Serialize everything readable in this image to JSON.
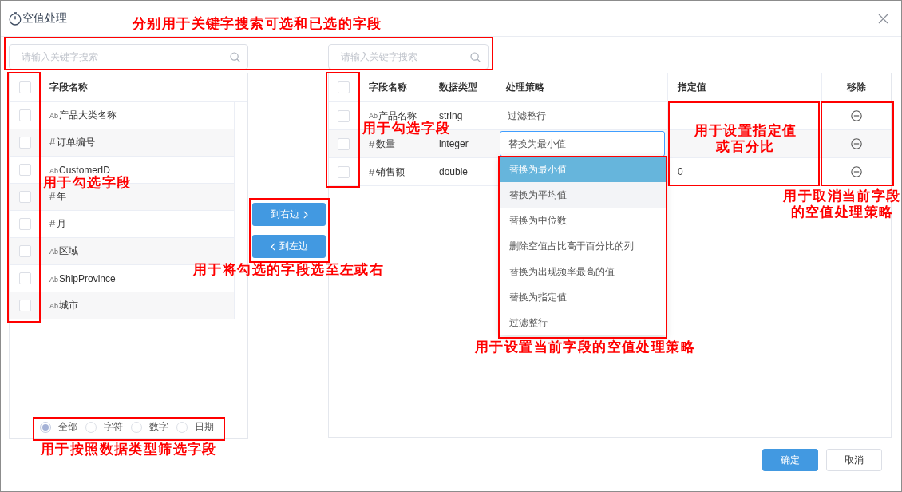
{
  "window": {
    "title": "空值处理"
  },
  "left_panel": {
    "search": {
      "placeholder": "请输入关键字搜索"
    },
    "select_all": {
      "checked": false
    },
    "column": "字段名称",
    "fields": [
      {
        "kind": "text",
        "type_mark": "Ab",
        "name": "产品大类名称",
        "checked": false
      },
      {
        "kind": "number",
        "type_mark": "#",
        "name": "订单编号",
        "checked": false
      },
      {
        "kind": "text",
        "type_mark": "Ab",
        "name": "CustomerID",
        "checked": false
      },
      {
        "kind": "number",
        "type_mark": "#",
        "name": "年",
        "checked": false
      },
      {
        "kind": "number",
        "type_mark": "#",
        "name": "月",
        "checked": false
      },
      {
        "kind": "text",
        "type_mark": "Ab",
        "name": "区域",
        "checked": false
      },
      {
        "kind": "text",
        "type_mark": "Ab",
        "name": "ShipProvince",
        "checked": false
      },
      {
        "kind": "text",
        "type_mark": "Ab",
        "name": "城市",
        "checked": false
      }
    ],
    "type_filters": [
      {
        "label": "全部",
        "selected": true
      },
      {
        "label": "字符",
        "selected": false
      },
      {
        "label": "数字",
        "selected": false
      },
      {
        "label": "日期",
        "selected": false
      }
    ]
  },
  "transfer_buttons": [
    {
      "label": "到右边",
      "kind": "right"
    },
    {
      "label": "到左边",
      "kind": "left"
    }
  ],
  "right_panel": {
    "search": {
      "placeholder": "请输入关键字搜索"
    },
    "table": {
      "select_all": {
        "checked": false
      },
      "columns": [
        "字段名称",
        "数据类型",
        "处理策略",
        "指定值",
        "移除"
      ],
      "rows": [
        {
          "kind": "text",
          "type_mark": "Ab",
          "name": "产品名称",
          "data_type": "string",
          "strategy": "过滤整行",
          "open": false,
          "checked": false
        },
        {
          "kind": "number",
          "type_mark": "#",
          "name": "数量",
          "data_type": "integer",
          "strategy": "替换为最小值",
          "open": true,
          "checked": false
        },
        {
          "kind": "number",
          "type_mark": "#",
          "name": "销售额",
          "data_type": "double",
          "value": "0",
          "open": false,
          "checked": false
        }
      ]
    },
    "strategy_menu": {
      "options": [
        {
          "label": "替换为最小值",
          "selected": true,
          "hovered": false
        },
        {
          "label": "替换为平均值",
          "selected": false,
          "hovered": true
        },
        {
          "label": "替换为中位数",
          "selected": false,
          "hovered": false
        },
        {
          "label": "删除空值占比高于百分比的列",
          "selected": false,
          "hovered": false
        },
        {
          "label": "替换为出现频率最高的值",
          "selected": false,
          "hovered": false
        },
        {
          "label": "替换为指定值",
          "selected": false,
          "hovered": false
        },
        {
          "label": "过滤整行",
          "selected": false,
          "hovered": false
        }
      ]
    }
  },
  "footer": {
    "buttons": [
      {
        "label": "确定",
        "kind": "primary"
      },
      {
        "label": "取消",
        "kind": "default"
      }
    ]
  },
  "annotations": [
    {
      "text": "分别用于关键字搜索可选和已选的字段"
    },
    {
      "text": "用于勾选字段"
    },
    {
      "text": "用于设置指定值或百分比"
    },
    {
      "text": "用于勾选字段"
    },
    {
      "text": "用于取消当前字段的空值处理策略"
    },
    {
      "text": "用于将勾选的字段选至左或右"
    },
    {
      "text": "用于设置当前字段的空值处理策略"
    },
    {
      "text": "用于按照数据类型筛选字段"
    }
  ]
}
